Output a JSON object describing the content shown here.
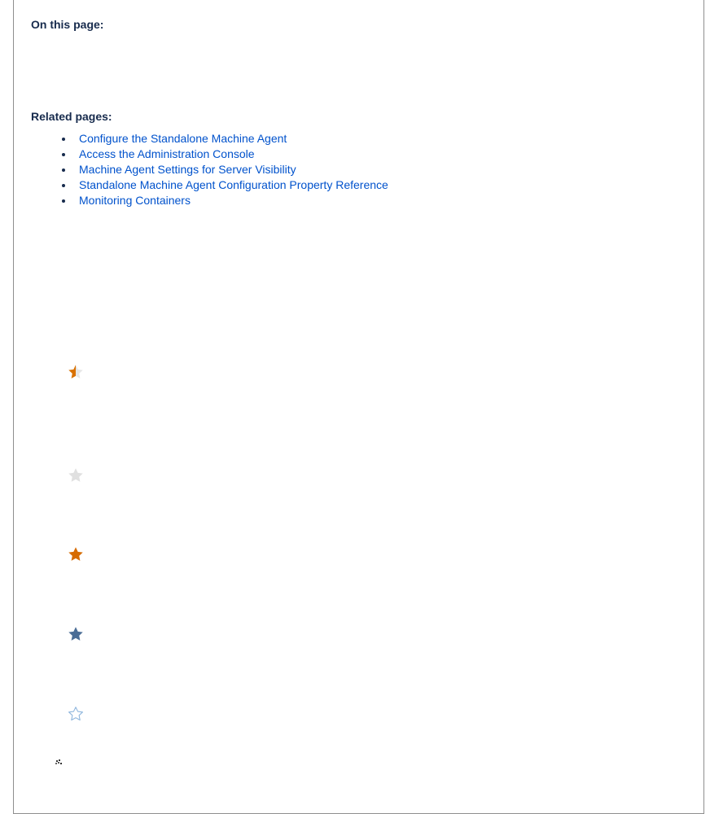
{
  "sections": {
    "on_this_page": "On this page:",
    "related_pages": "Related pages:"
  },
  "related_links": [
    "Configure the Standalone Machine Agent",
    "Access the Administration Console",
    "Machine Agent Settings for Server Visibility",
    "Standalone Machine Agent Configuration Property Reference",
    "Monitoring Containers"
  ],
  "icons": [
    {
      "name": "half-star-icon",
      "color": "#d97100",
      "secondary": "#e6e6e6"
    },
    {
      "name": "grey-star-icon",
      "color": "#e0e0e0"
    },
    {
      "name": "orange-star-icon",
      "color": "#d66b00"
    },
    {
      "name": "blue-star-icon",
      "color": "#4a6d96"
    },
    {
      "name": "outline-star-icon",
      "color": "#8fb6dd"
    },
    {
      "name": "tiny-decorative-icon",
      "color": "#333333"
    }
  ],
  "colors": {
    "link": "#0052cc",
    "text": "#172b4d",
    "border": "#8f8f8f"
  }
}
